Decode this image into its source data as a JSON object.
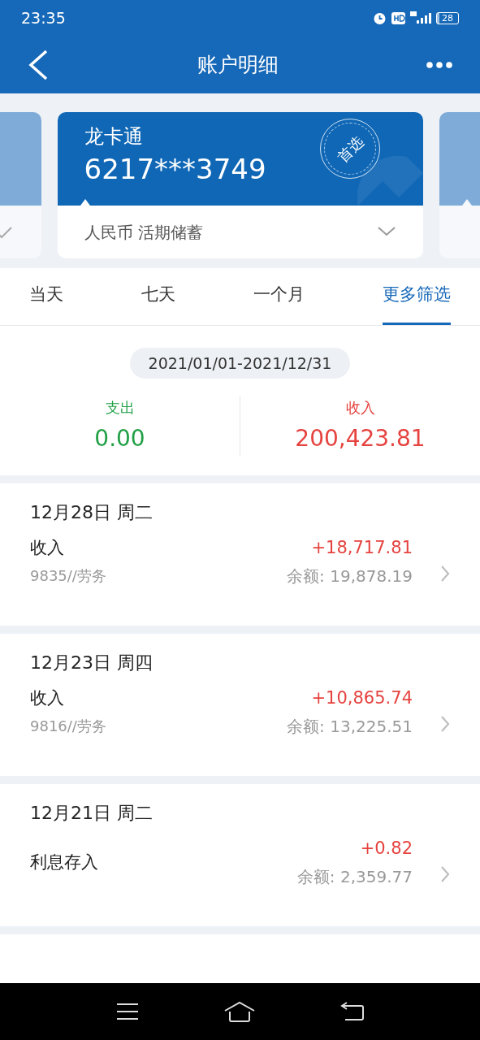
{
  "status_bar": {
    "time": "23:35",
    "battery": "28"
  },
  "header": {
    "title": "账户明细"
  },
  "cards": [
    {
      "kind": "side",
      "selected": false,
      "check": true
    },
    {
      "kind": "main",
      "selected": true,
      "name": "龙卡通",
      "number": "6217***3749",
      "stamp": "首选",
      "account": "人民币 活期储蓄"
    },
    {
      "kind": "side",
      "selected": false
    }
  ],
  "tabs": [
    {
      "label": "当天",
      "selected": false
    },
    {
      "label": "七天",
      "selected": false
    },
    {
      "label": "一个月",
      "selected": false
    },
    {
      "label": "更多筛选",
      "selected": true
    }
  ],
  "date_range": "2021/01/01-2021/12/31",
  "summary": [
    {
      "kind": "expense",
      "label": "支出",
      "amount": "0.00"
    },
    {
      "kind": "income",
      "label": "收入",
      "amount": "200,423.81"
    }
  ],
  "transactions": [
    {
      "date": "12月28日 周二",
      "type": "收入",
      "note": "9835//劳务",
      "amount": "+18,717.81",
      "balance": "余额: 19,878.19"
    },
    {
      "date": "12月23日 周四",
      "type": "收入",
      "note": "9816//劳务",
      "amount": "+10,865.74",
      "balance": "余额: 13,225.51"
    },
    {
      "date": "12月21日 周二",
      "type": "利息存入",
      "amount": "+0.82",
      "balance": "余额: 2,359.77"
    }
  ]
}
